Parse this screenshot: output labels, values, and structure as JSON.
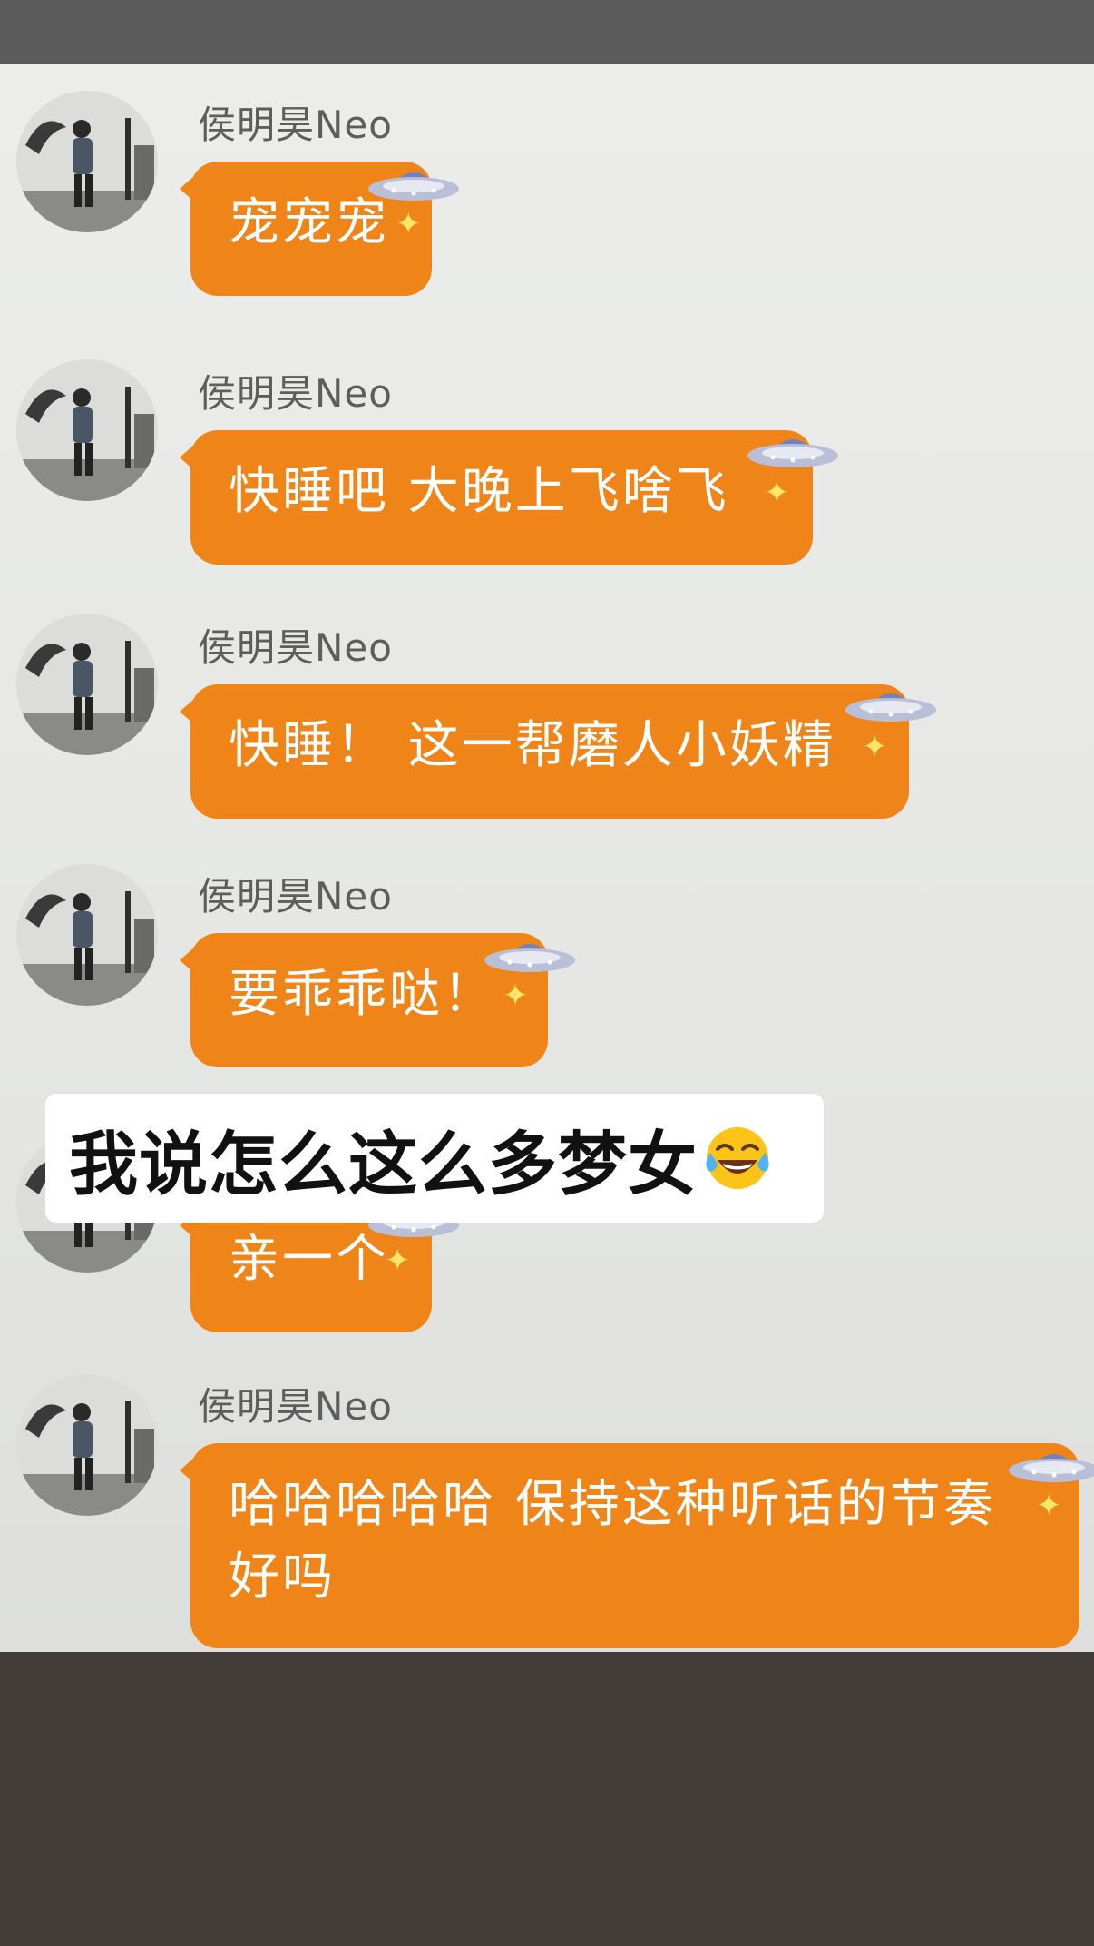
{
  "conversation": {
    "sender_name": "侯明昊Neo",
    "messages": [
      {
        "text": "宠宠宠"
      },
      {
        "text": "快睡吧  大晚上飞啥飞"
      },
      {
        "text": "快睡！  这一帮磨人小妖精"
      },
      {
        "text": "要乖乖哒！"
      },
      {
        "text": "亲一个"
      },
      {
        "text": "哈哈哈哈哈 保持这种听话的节奏好吗"
      }
    ]
  },
  "overlay": {
    "caption": "我说怎么这么多梦女",
    "emoji": "face-with-tears-of-joy-icon"
  },
  "icons": {
    "bubble_decoration": "ufo-icon",
    "sparkle": "sparkle-icon"
  },
  "colors": {
    "bubble": "#ef8418",
    "bubble_text": "#ffffff",
    "sender_name": "#5d5d5d",
    "chat_background": "#e8e9e6",
    "top_bar": "#5b5b5b",
    "bottom_area": "#423d38"
  }
}
